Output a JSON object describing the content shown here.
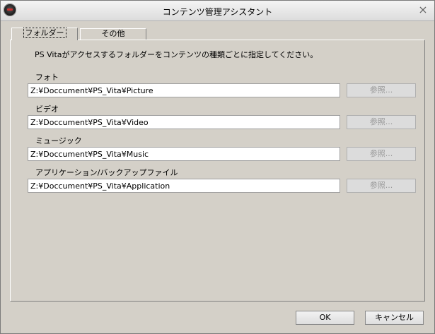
{
  "window": {
    "title": "コンテンツ管理アシスタント",
    "close_glyph": "⨯"
  },
  "tabs": [
    {
      "label": "フォルダー",
      "active": true
    },
    {
      "label": "その他",
      "active": false
    }
  ],
  "description": "PS Vitaがアクセスするフォルダーをコンテンツの種類ごとに指定してください。",
  "fields": [
    {
      "label": "フォト",
      "value": "Z:¥Doccument¥PS_Vita¥Picture",
      "browse_label": "参照..."
    },
    {
      "label": "ビデオ",
      "value": "Z:¥Doccument¥PS_Vita¥Video",
      "browse_label": "参照..."
    },
    {
      "label": "ミュージック",
      "value": "Z:¥Doccument¥PS_Vita¥Music",
      "browse_label": "参照..."
    },
    {
      "label": "アプリケーション/バックアップファイル",
      "value": "Z:¥Doccument¥PS_Vita¥Application",
      "browse_label": "参照..."
    }
  ],
  "buttons": {
    "ok": "OK",
    "cancel": "キャンセル"
  },
  "colors": {
    "window_bg": "#d4d0c8",
    "disabled_text": "#9a9a9a"
  }
}
